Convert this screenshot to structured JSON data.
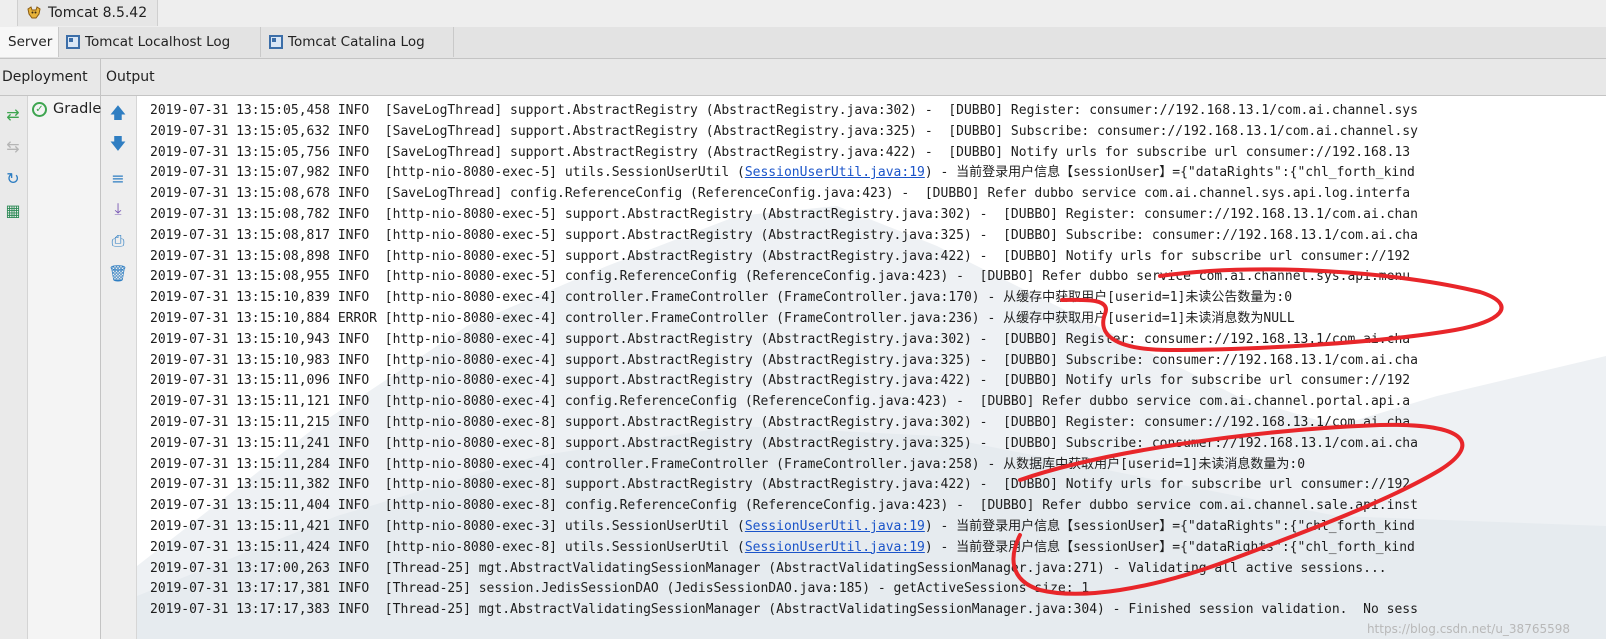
{
  "run_tab": {
    "label": "Tomcat 8.5.42",
    "icon": "tomcat-icon"
  },
  "tabs": [
    {
      "label": "Server"
    },
    {
      "label": "Tomcat Localhost Log"
    },
    {
      "label": "Tomcat Catalina Log"
    }
  ],
  "headers": {
    "deployment": "Deployment",
    "output": "Output"
  },
  "deployment": {
    "item": "Gradle"
  },
  "log_lines": [
    {
      "pre": "2019-07-31 13:15:05,458 INFO  [SaveLogThread] support.AbstractRegistry (AbstractRegistry.java:302) -  [DUBBO] Register: consumer://192.168.13.1/com.ai.channel.sys",
      "link": "",
      "post": ""
    },
    {
      "pre": "2019-07-31 13:15:05,632 INFO  [SaveLogThread] support.AbstractRegistry (AbstractRegistry.java:325) -  [DUBBO] Subscribe: consumer://192.168.13.1/com.ai.channel.sy",
      "link": "",
      "post": ""
    },
    {
      "pre": "2019-07-31 13:15:05,756 INFO  [SaveLogThread] support.AbstractRegistry (AbstractRegistry.java:422) -  [DUBBO] Notify urls for subscribe url consumer://192.168.13",
      "link": "",
      "post": ""
    },
    {
      "pre": "2019-07-31 13:15:07,982 INFO  [http-nio-8080-exec-5] utils.SessionUserUtil (",
      "link": "SessionUserUtil.java:19",
      "post": ") - 当前登录用户信息【sessionUser】={\"dataRights\":{\"chl_forth_kind"
    },
    {
      "pre": "2019-07-31 13:15:08,678 INFO  [SaveLogThread] config.ReferenceConfig (ReferenceConfig.java:423) -  [DUBBO] Refer dubbo service com.ai.channel.sys.api.log.interfa",
      "link": "",
      "post": ""
    },
    {
      "pre": "2019-07-31 13:15:08,782 INFO  [http-nio-8080-exec-5] support.AbstractRegistry (AbstractRegistry.java:302) -  [DUBBO] Register: consumer://192.168.13.1/com.ai.chan",
      "link": "",
      "post": ""
    },
    {
      "pre": "2019-07-31 13:15:08,817 INFO  [http-nio-8080-exec-5] support.AbstractRegistry (AbstractRegistry.java:325) -  [DUBBO] Subscribe: consumer://192.168.13.1/com.ai.cha",
      "link": "",
      "post": ""
    },
    {
      "pre": "2019-07-31 13:15:08,898 INFO  [http-nio-8080-exec-5] support.AbstractRegistry (AbstractRegistry.java:422) -  [DUBBO] Notify urls for subscribe url consumer://192",
      "link": "",
      "post": ""
    },
    {
      "pre": "2019-07-31 13:15:08,955 INFO  [http-nio-8080-exec-5] config.ReferenceConfig (ReferenceConfig.java:423) -  [DUBBO] Refer dubbo service com.ai.channel.sys.api.menu",
      "link": "",
      "post": ""
    },
    {
      "pre": "2019-07-31 13:15:10,839 INFO  [http-nio-8080-exec-4] controller.FrameController (FrameController.java:170) - 从缓存中获取用户[userid=1]未读公告数量为:0",
      "link": "",
      "post": ""
    },
    {
      "pre": "2019-07-31 13:15:10,884 ERROR [http-nio-8080-exec-4] controller.FrameController (FrameController.java:236) - 从缓存中获取用户[userid=1]未读消息数为NULL",
      "link": "",
      "post": ""
    },
    {
      "pre": "2019-07-31 13:15:10,943 INFO  [http-nio-8080-exec-4] support.AbstractRegistry (AbstractRegistry.java:302) -  [DUBBO] Register: consumer://192.168.13.1/com.ai.cha",
      "link": "",
      "post": ""
    },
    {
      "pre": "2019-07-31 13:15:10,983 INFO  [http-nio-8080-exec-4] support.AbstractRegistry (AbstractRegistry.java:325) -  [DUBBO] Subscribe: consumer://192.168.13.1/com.ai.cha",
      "link": "",
      "post": ""
    },
    {
      "pre": "2019-07-31 13:15:11,096 INFO  [http-nio-8080-exec-4] support.AbstractRegistry (AbstractRegistry.java:422) -  [DUBBO] Notify urls for subscribe url consumer://192",
      "link": "",
      "post": ""
    },
    {
      "pre": "2019-07-31 13:15:11,121 INFO  [http-nio-8080-exec-4] config.ReferenceConfig (ReferenceConfig.java:423) -  [DUBBO] Refer dubbo service com.ai.channel.portal.api.a",
      "link": "",
      "post": ""
    },
    {
      "pre": "2019-07-31 13:15:11,215 INFO  [http-nio-8080-exec-8] support.AbstractRegistry (AbstractRegistry.java:302) -  [DUBBO] Register: consumer://192.168.13.1/com.ai.cha",
      "link": "",
      "post": ""
    },
    {
      "pre": "2019-07-31 13:15:11,241 INFO  [http-nio-8080-exec-8] support.AbstractRegistry (AbstractRegistry.java:325) -  [DUBBO] Subscribe: consumer://192.168.13.1/com.ai.cha",
      "link": "",
      "post": ""
    },
    {
      "pre": "2019-07-31 13:15:11,284 INFO  [http-nio-8080-exec-4] controller.FrameController (FrameController.java:258) - 从数据库中获取用户[userid=1]未读消息数量为:0",
      "link": "",
      "post": ""
    },
    {
      "pre": "2019-07-31 13:15:11,382 INFO  [http-nio-8080-exec-8] support.AbstractRegistry (AbstractRegistry.java:422) -  [DUBBO] Notify urls for subscribe url consumer://192",
      "link": "",
      "post": ""
    },
    {
      "pre": "2019-07-31 13:15:11,404 INFO  [http-nio-8080-exec-8] config.ReferenceConfig (ReferenceConfig.java:423) -  [DUBBO] Refer dubbo service com.ai.channel.sale.api.inst",
      "link": "",
      "post": ""
    },
    {
      "pre": "2019-07-31 13:15:11,421 INFO  [http-nio-8080-exec-3] utils.SessionUserUtil (",
      "link": "SessionUserUtil.java:19",
      "post": ") - 当前登录用户信息【sessionUser】={\"dataRights\":{\"chl_forth_kind"
    },
    {
      "pre": "2019-07-31 13:15:11,424 INFO  [http-nio-8080-exec-8] utils.SessionUserUtil (",
      "link": "SessionUserUtil.java:19",
      "post": ") - 当前登录用户信息【sessionUser】={\"dataRights\":{\"chl_forth_kind"
    },
    {
      "pre": "2019-07-31 13:17:00,263 INFO  [Thread-25] mgt.AbstractValidatingSessionManager (AbstractValidatingSessionManager.java:271) - Validating all active sessions...",
      "link": "",
      "post": ""
    },
    {
      "pre": "2019-07-31 13:17:17,381 INFO  [Thread-25] session.JedisSessionDAO (JedisSessionDAO.java:185) - getActiveSessions size: 1",
      "link": "",
      "post": ""
    },
    {
      "pre": "2019-07-31 13:17:17,383 INFO  [Thread-25] mgt.AbstractValidatingSessionManager (AbstractValidatingSessionManager.java:304) - Finished session validation.  No sess",
      "link": "",
      "post": ""
    }
  ],
  "watermark": "https://blog.csdn.net/u_38765598",
  "colors": {
    "annotation": "#e8262a",
    "link": "#1b54c9",
    "ok": "#3ea550"
  }
}
